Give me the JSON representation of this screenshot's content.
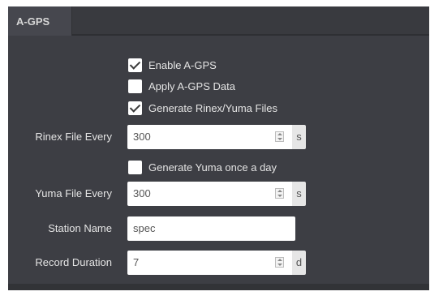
{
  "panel": {
    "tab_label": "A-GPS"
  },
  "checkboxes": {
    "enable_agps": {
      "label": "Enable A-GPS",
      "checked": true
    },
    "apply_agps_data": {
      "label": "Apply A-GPS Data",
      "checked": false
    },
    "generate_rinex_yuma": {
      "label": "Generate Rinex/Yuma Files",
      "checked": true
    },
    "generate_yuma_daily": {
      "label": "Generate Yuma once a day",
      "checked": false
    }
  },
  "fields": {
    "rinex_file_every": {
      "label": "Rinex File Every",
      "value": "300",
      "unit": "s"
    },
    "yuma_file_every": {
      "label": "Yuma File Every",
      "value": "300",
      "unit": "s"
    },
    "station_name": {
      "label": "Station Name",
      "value": "spec"
    },
    "record_duration": {
      "label": "Record Duration",
      "value": "7",
      "unit": "d"
    }
  },
  "icons": {
    "spinner": "spinner-arrows-icon",
    "checkmark": "checkmark-icon"
  },
  "colors": {
    "panel_background": "#3d3e44",
    "text": "#e4e4e4",
    "input_background": "#ffffff",
    "unit_background": "#e6e6e6"
  }
}
